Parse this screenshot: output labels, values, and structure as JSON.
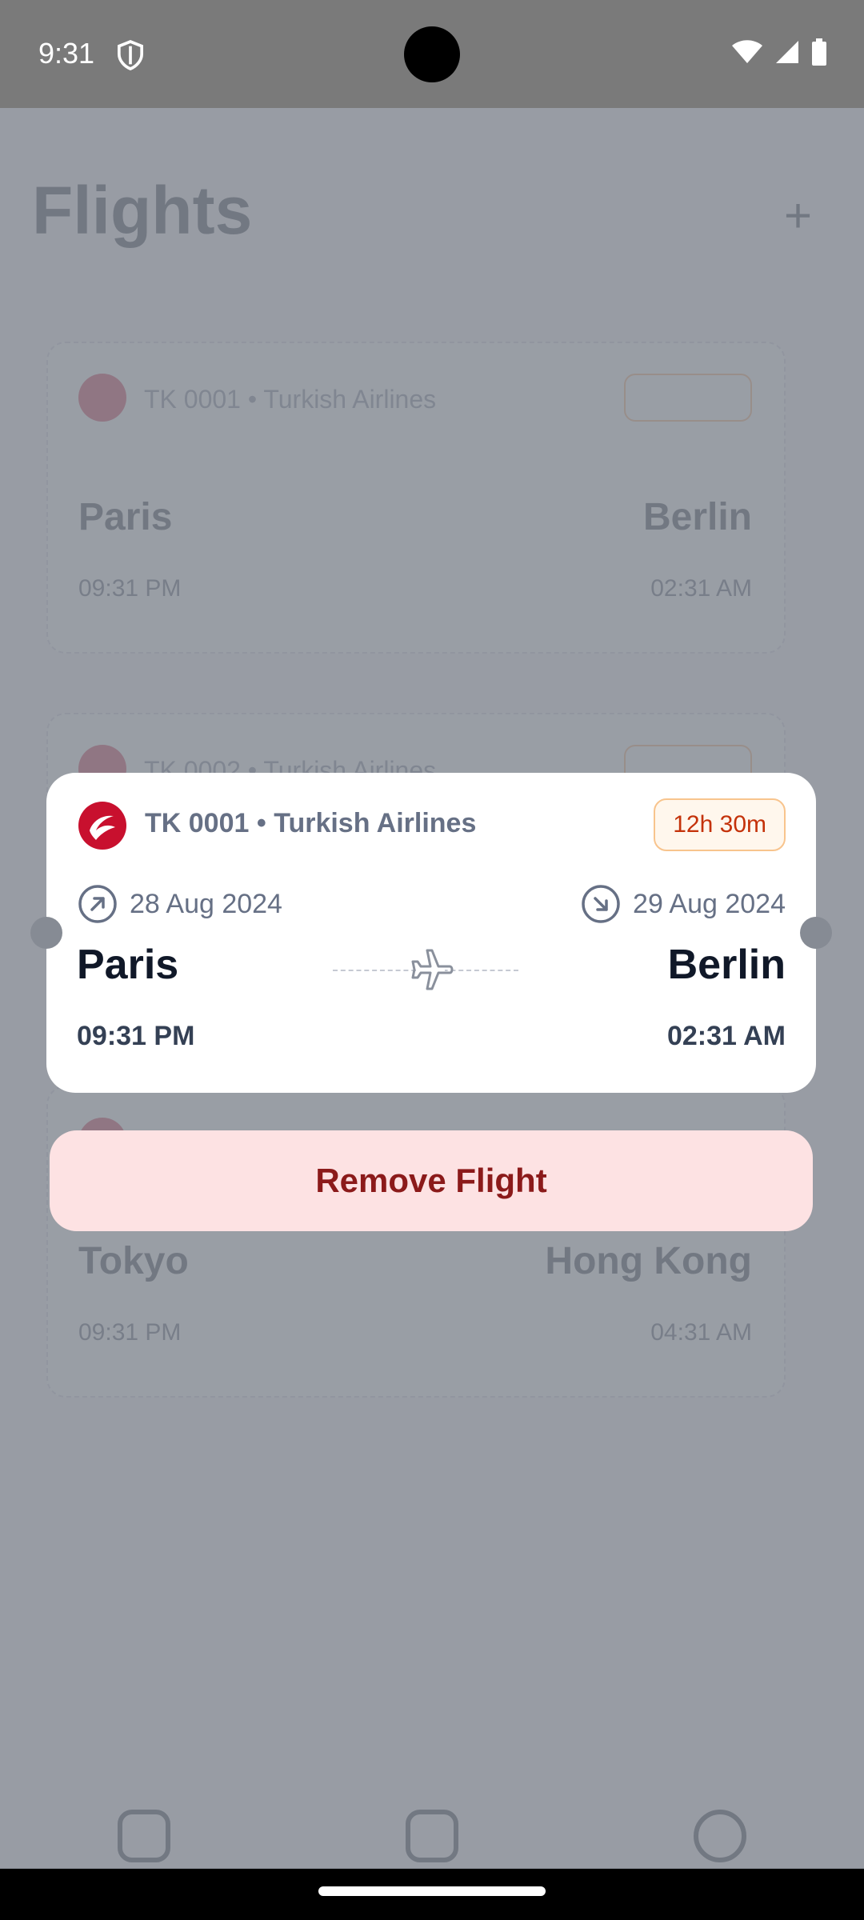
{
  "status_bar": {
    "time": "9:31"
  },
  "background": {
    "title": "Flights",
    "cards": [
      {
        "line": "TK 0001 • Turkish Airlines",
        "from": "Paris",
        "to": "Berlin",
        "dep_time": "09:31 PM",
        "arr_time": "02:31 AM"
      },
      {
        "line": "TK 0002 • Turkish Airlines",
        "from": "",
        "to": "",
        "dep_time": "",
        "arr_time": ""
      },
      {
        "line": "",
        "from": "Tokyo",
        "to": "Hong Kong",
        "dep_time": "09:31 PM",
        "arr_time": "04:31 AM"
      }
    ],
    "nav": [
      {
        "icon": "home-icon"
      },
      {
        "icon": "flights-icon"
      },
      {
        "icon": "profile-icon"
      }
    ]
  },
  "flight_card": {
    "flight_number": "TK 0001",
    "airline": "Turkish Airlines",
    "line": "TK 0001 • Turkish Airlines",
    "duration": "12h 30m",
    "departure_date": "28 Aug 2024",
    "arrival_date": "29 Aug 2024",
    "from_city": "Paris",
    "to_city": "Berlin",
    "departure_time": "09:31 PM",
    "arrival_time": "02:31 AM"
  },
  "actions": {
    "remove_label": "Remove Flight"
  },
  "colors": {
    "airline_red": "#c8102e",
    "badge_text": "#c4320a",
    "remove_bg": "#fde2e3",
    "remove_text": "#8b1a1a"
  }
}
